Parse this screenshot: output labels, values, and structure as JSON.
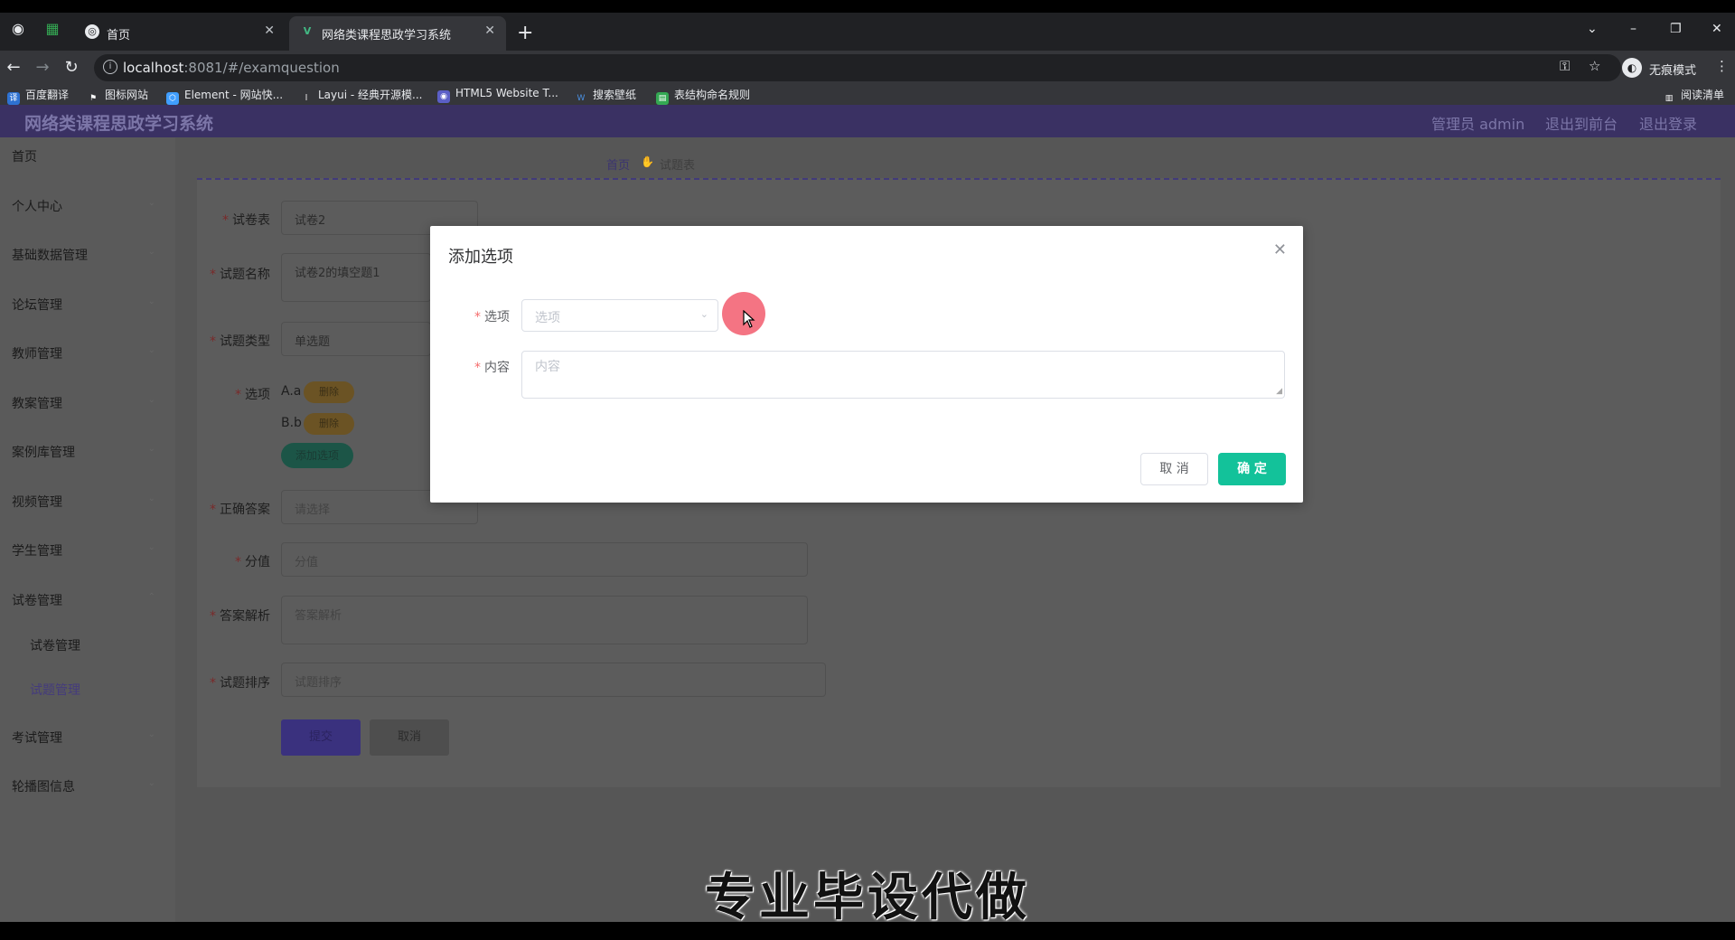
{
  "browser": {
    "tabs": [
      {
        "title": "首页",
        "active": false
      },
      {
        "title": "网络类课程思政学习系统",
        "active": true
      }
    ],
    "url_host": "localhost",
    "url_rest": ":8081/#/examquestion",
    "incognito_label": "无痕模式",
    "bookmarks": [
      "百度翻译",
      "图标网站",
      "Element - 网站快...",
      "Layui - 经典开源模...",
      "HTML5 Website T...",
      "搜索壁纸",
      "表结构命名规则"
    ],
    "reading_list": "阅读清单"
  },
  "header": {
    "title": "网络类课程思政学习系统",
    "user": "管理员 admin",
    "back_front": "退出到前台",
    "logout": "退出登录"
  },
  "sidebar": {
    "items": [
      "首页",
      "个人中心",
      "基础数据管理",
      "论坛管理",
      "教师管理",
      "教案管理",
      "案例库管理",
      "视频管理",
      "学生管理",
      "试卷管理"
    ],
    "sub_items": [
      "试卷管理",
      "试题管理"
    ],
    "items_after": [
      "考试管理",
      "轮播图信息"
    ],
    "active_sub": "试题管理"
  },
  "breadcrumb": {
    "home": "首页",
    "current": "试题表"
  },
  "form": {
    "paper_label": "试卷表",
    "paper_value": "试卷2",
    "name_label": "试题名称",
    "name_value": "试卷2的填空题1",
    "type_label": "试题类型",
    "type_value": "单选题",
    "options_label": "选项",
    "options": [
      {
        "text": "A.a",
        "delete": "删除"
      },
      {
        "text": "B.b",
        "delete": "删除"
      }
    ],
    "add_option": "添加选项",
    "answer_label": "正确答案",
    "answer_placeholder": "请选择",
    "score_label": "分值",
    "score_placeholder": "分值",
    "analysis_label": "答案解析",
    "analysis_placeholder": "答案解析",
    "order_label": "试题排序",
    "order_placeholder": "试题排序",
    "submit": "提交",
    "cancel": "取消"
  },
  "dialog": {
    "title": "添加选项",
    "option_label": "选项",
    "option_placeholder": "选项",
    "content_label": "内容",
    "content_placeholder": "内容",
    "cancel": "取 消",
    "confirm": "确 定"
  },
  "subtitle": "专业毕设代做",
  "colors": {
    "header_bg": "#3a3163",
    "confirm_button": "#13c29a",
    "required_mark": "#f56c6c"
  }
}
